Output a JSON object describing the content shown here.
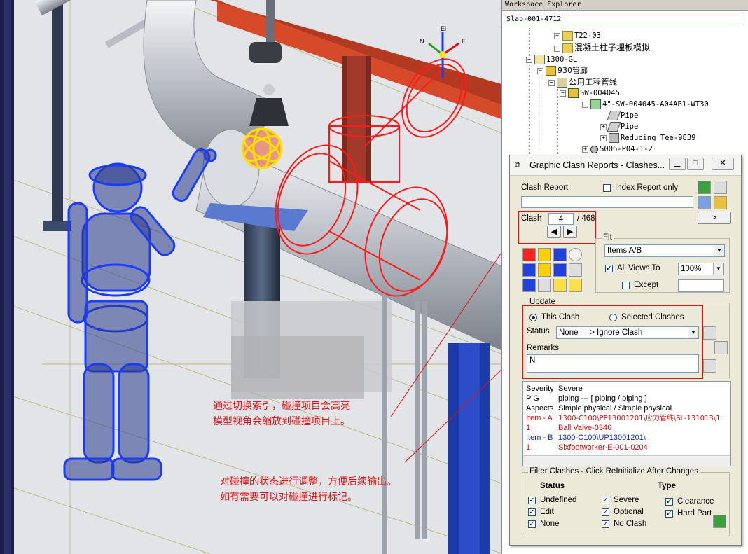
{
  "explorer": {
    "title": "Workspace Explorer",
    "path": "Slab-001-4712",
    "tree": [
      {
        "label": "T22-03"
      },
      {
        "label": "混凝土柱子埋板模拟"
      },
      {
        "label": "1300-GL"
      },
      {
        "label": "930管廊"
      },
      {
        "label": "公用工程管线"
      },
      {
        "label": "SW-004045"
      },
      {
        "label": "4\"-SW-004045-A04AB1-WT30"
      },
      {
        "label": "Pipe"
      },
      {
        "label": "Pipe"
      },
      {
        "label": "Reducing Tee-9839"
      },
      {
        "label": "S006-P04-1-2"
      }
    ]
  },
  "dialog": {
    "title": "Graphic Clash Reports - Clashes...",
    "clash_report_label": "Clash Report",
    "index_report_only": "Index Report only",
    "clash_label": "Clash",
    "clash_current": "4",
    "clash_total": "/ 468",
    "next_label": ">",
    "fit": {
      "title": "Fit",
      "items": "Items A/B",
      "all_views_to": "All Views To",
      "zoom": "100%",
      "except": "Except"
    },
    "update": {
      "title": "Update",
      "this_clash": "This Clash",
      "selected_clashes": "Selected Clashes",
      "status_label": "Status",
      "status_value": "None ==> Ignore Clash",
      "remarks_label": "Remarks",
      "remarks_value": "N"
    },
    "details": [
      {
        "key": "Severity",
        "value": "Severe"
      },
      {
        "key": "P G",
        "value": "piping  ---  [ piping / piping ]"
      },
      {
        "key": "Aspects",
        "value": "Simple physical / Simple physical"
      },
      {
        "key": "Item - A",
        "value": "1300-C100\\PP13001201\\应力管线\\SL-131013\\1"
      },
      {
        "key": "1",
        "value": "Ball Valve-0346"
      },
      {
        "key": "Item - B",
        "value": "1300-C100\\UP13001201\\"
      },
      {
        "key": "1",
        "value": "Sixfootworker-E-001-0204"
      }
    ],
    "filter": {
      "title": "Filter Clashes - Click ReInitialize After Changes",
      "status_header": "Status",
      "type_header": "Type",
      "status_items": [
        "Undefined",
        "Edit",
        "None"
      ],
      "severity_items": [
        "Severe",
        "Optional",
        "No Clash"
      ],
      "type_items": [
        "Clearance",
        "Hard Part"
      ]
    }
  },
  "annotations": {
    "note1_line1": "通过切换索引，碰撞项目会高亮",
    "note1_line2": "模型视角会缩放到碰撞项目上。",
    "note2_line1": "对碰撞的状态进行调整，方便后续输出。",
    "note2_line2": "如有需要可以对碰撞进行标记。"
  },
  "colors": {
    "highlight_red": "#ff1a1a",
    "worker_blue": "#1a3cff",
    "ball_yellow": "#ffe000",
    "accent_green": "#2aa02a"
  },
  "icons": [
    "refresh-icon",
    "save-icon",
    "open-folder-icon",
    "color-legend-icon",
    "pointer-icon",
    "person-icon"
  ],
  "viewport": {
    "axis_labels": [
      "El",
      "E",
      "N"
    ]
  }
}
